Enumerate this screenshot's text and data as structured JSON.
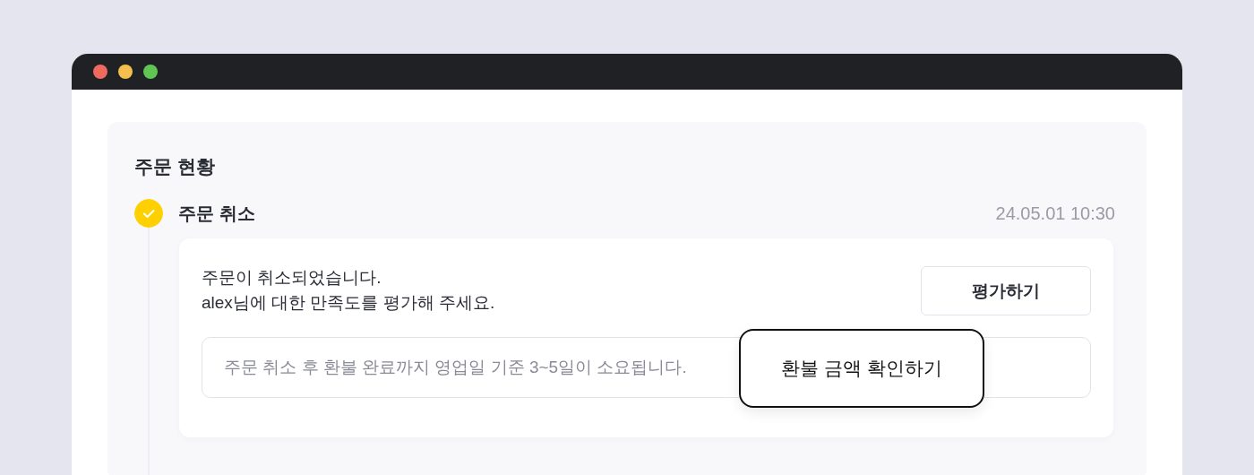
{
  "panel": {
    "title": "주문 현황"
  },
  "steps": [
    {
      "title": "주문 취소",
      "time": "24.05.01 10:30",
      "completed": true,
      "message": [
        "주문이 취소되었습니다.",
        "alex님에 대한 만족도를 평가해 주세요."
      ],
      "action": "평가하기",
      "notice": "주문 취소 후 환불 완료까지 영업일 기준 3~5일이 소요됩니다.",
      "popup_button": "환불 금액 확인하기"
    }
  ]
}
